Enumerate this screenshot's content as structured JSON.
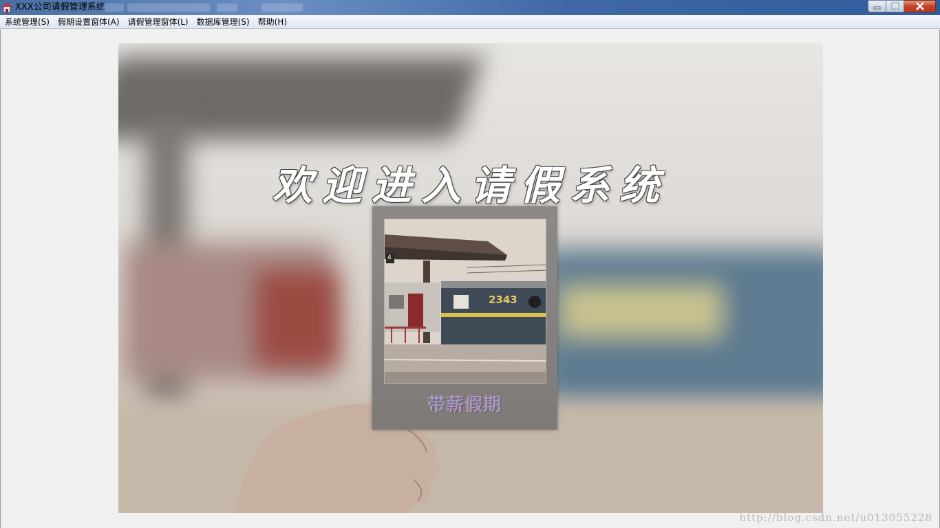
{
  "window": {
    "title": "XXX公司请假管理系统",
    "icon": "app-house-icon",
    "controls": {
      "minimize_icon": "minimize-icon",
      "maximize_icon": "maximize-icon",
      "close_icon": "close-icon"
    }
  },
  "menubar": {
    "items": [
      {
        "label": "系统管理(S)"
      },
      {
        "label": "假期设置窗体(A)"
      },
      {
        "label": "请假管理窗体(L)"
      },
      {
        "label": "数据库管理(S)"
      },
      {
        "label": "帮助(H)"
      }
    ]
  },
  "main": {
    "welcome_text": "欢迎进入请假系统",
    "polaroid": {
      "train_number": "2343",
      "platform_sign": "4",
      "caption": "带薪假期"
    },
    "watermark": "http://blog.csdn.net/u013055228"
  },
  "colors": {
    "titlebar": "#4a6fa5",
    "menubar": "#e4e9f2",
    "client_bg": "#f0f0f0",
    "close_button": "#c2432a"
  }
}
